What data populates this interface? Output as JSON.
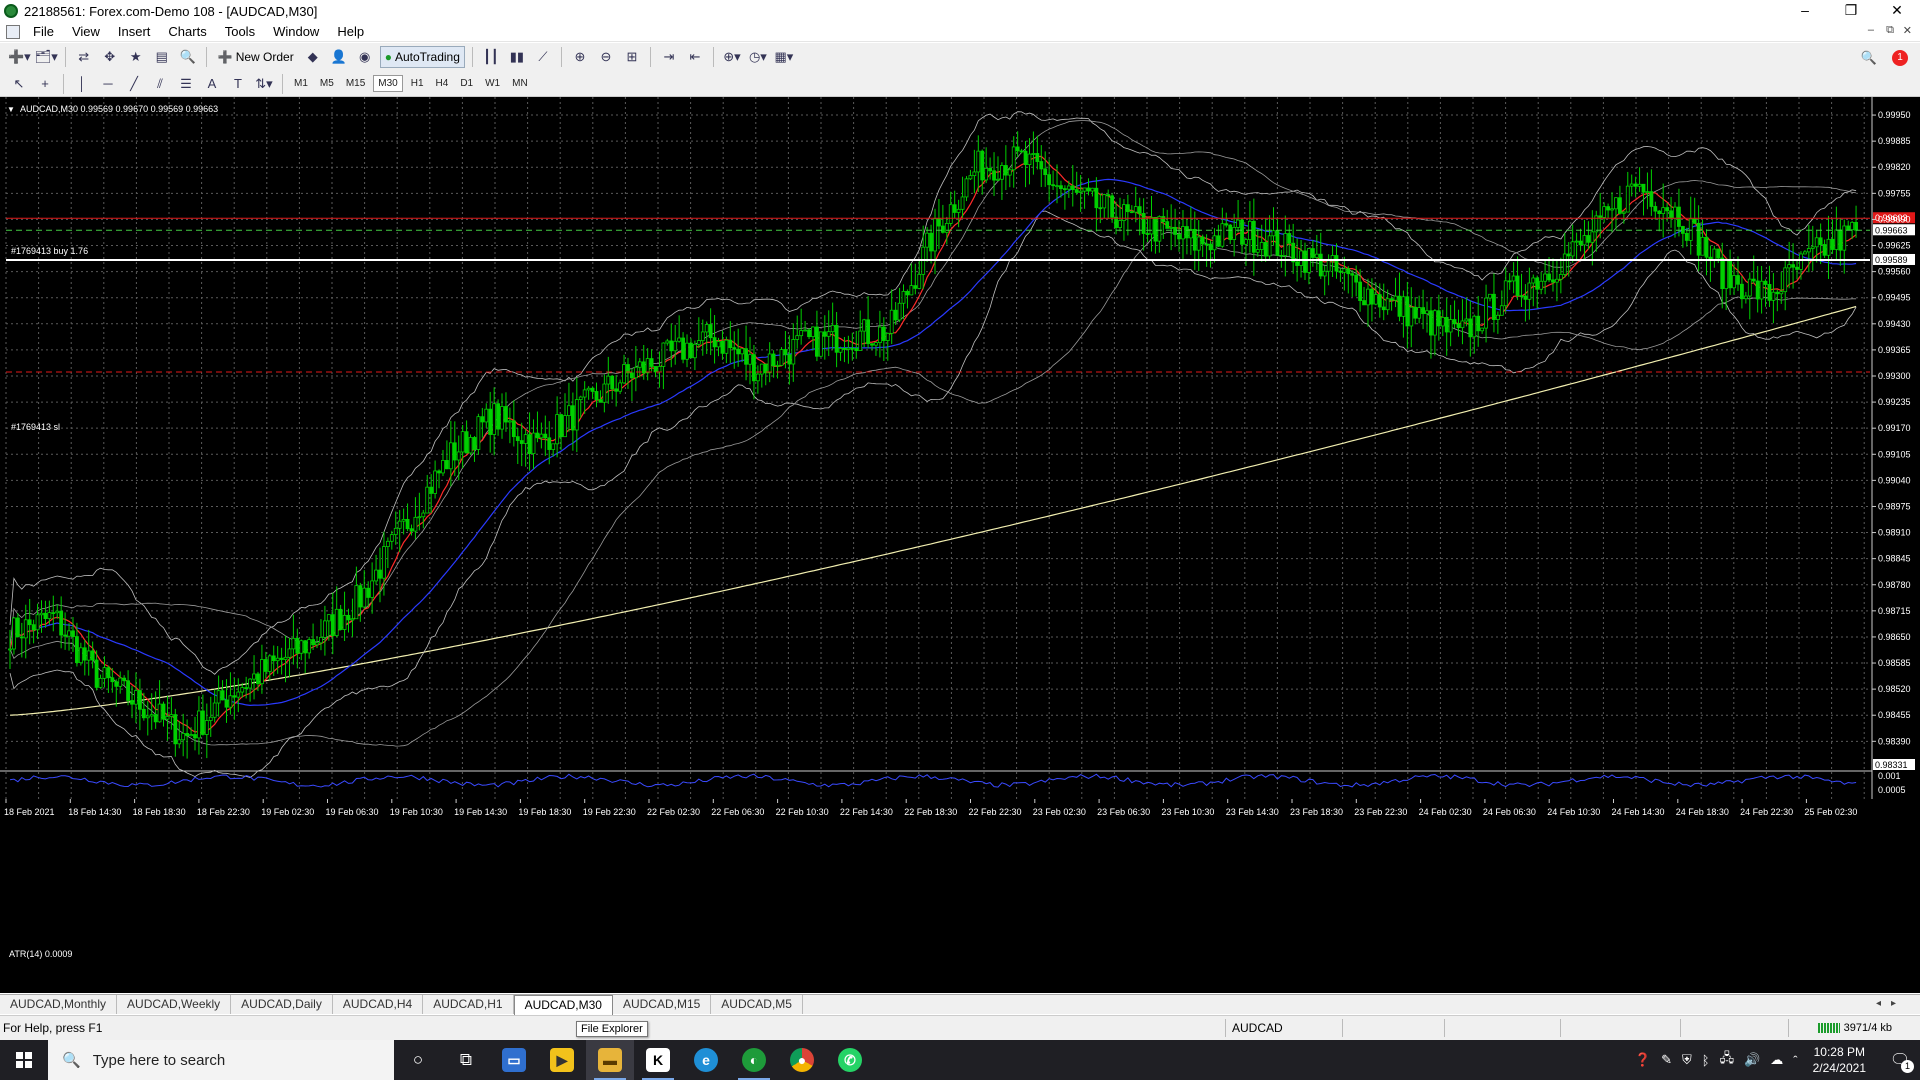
{
  "window": {
    "title": "22188561: Forex.com-Demo 108 - [AUDCAD,M30]",
    "controls": [
      "–",
      "❐",
      "✕"
    ],
    "mdi_controls": [
      "–",
      "⧉",
      "✕"
    ]
  },
  "menu": [
    "File",
    "View",
    "Insert",
    "Charts",
    "Tools",
    "Window",
    "Help"
  ],
  "toolbar": {
    "new_order": "New Order",
    "auto_trading": "AutoTrading",
    "notification_count": "1"
  },
  "timeframes": [
    "M1",
    "M5",
    "M15",
    "M30",
    "H1",
    "H4",
    "D1",
    "W1",
    "MN"
  ],
  "active_timeframe": "M30",
  "chart": {
    "header": "AUDCAD,M30  0.99569 0.99670 0.99569 0.99663",
    "order_label": "#1769413 buy 1.76",
    "sl_label": "#1769413 sl",
    "atr_label": "ATR(14) 0.0009",
    "current_price": "0.99663",
    "red_price": "0.99693",
    "white_line_price": "0.99589",
    "bottom_price": "0.98331",
    "atr_scale": [
      "0.001",
      "0.0005"
    ],
    "colors": {
      "background": "#000000",
      "grid": "#5a5a5a",
      "candle": "#00d000",
      "ma_red": "#ff2a2a",
      "ma_blue": "#2a3aff",
      "ma_yellow": "#f2efb0",
      "bands": "#c0c0c0"
    }
  },
  "chart_data": {
    "type": "line",
    "title": "AUDCAD,M30  0.99569 0.99670 0.99569 0.99663",
    "y_ticks": [
      0.9995,
      0.99885,
      0.9982,
      0.99755,
      0.9969,
      0.99625,
      0.9956,
      0.99495,
      0.9943,
      0.99365,
      0.993,
      0.99235,
      0.9917,
      0.99105,
      0.9904,
      0.98975,
      0.9891,
      0.98845,
      0.9878,
      0.98715,
      0.9865,
      0.98585,
      0.9852,
      0.98455,
      0.9839
    ],
    "ylim": [
      0.98331,
      0.9999
    ],
    "x_ticks": [
      "18 Feb 2021",
      "18 Feb 14:30",
      "18 Feb 18:30",
      "18 Feb 22:30",
      "19 Feb 02:30",
      "19 Feb 06:30",
      "19 Feb 10:30",
      "19 Feb 14:30",
      "19 Feb 18:30",
      "19 Feb 22:30",
      "22 Feb 02:30",
      "22 Feb 06:30",
      "22 Feb 10:30",
      "22 Feb 14:30",
      "22 Feb 18:30",
      "22 Feb 22:30",
      "23 Feb 02:30",
      "23 Feb 06:30",
      "23 Feb 10:30",
      "23 Feb 14:30",
      "23 Feb 18:30",
      "23 Feb 22:30",
      "24 Feb 02:30",
      "24 Feb 06:30",
      "24 Feb 10:30",
      "24 Feb 14:30",
      "24 Feb 18:30",
      "24 Feb 22:30",
      "25 Feb 02:30"
    ],
    "close_anchors": [
      0.9866,
      0.987,
      0.9855,
      0.9848,
      0.984,
      0.9851,
      0.9858,
      0.9865,
      0.9875,
      0.9893,
      0.991,
      0.992,
      0.9913,
      0.9922,
      0.993,
      0.9935,
      0.994,
      0.9932,
      0.9938,
      0.994,
      0.9941,
      0.9965,
      0.9982,
      0.9984,
      0.9976,
      0.9971,
      0.9967,
      0.9963,
      0.9966,
      0.9962,
      0.9957,
      0.995,
      0.9945,
      0.994,
      0.995,
      0.9956,
      0.9965,
      0.9978,
      0.997,
      0.9955,
      0.995,
      0.996,
      0.99663
    ],
    "order_buy_price": 0.99663,
    "stop_loss_price": 0.9931,
    "highlight_line_price": 0.99589,
    "red_line_price": 0.99693,
    "atr_value": 0.0009
  },
  "symbol_tabs": [
    "AUDCAD,Monthly",
    "AUDCAD,Weekly",
    "AUDCAD,Daily",
    "AUDCAD,H4",
    "AUDCAD,H1",
    "AUDCAD,M30",
    "AUDCAD,M15",
    "AUDCAD,M5"
  ],
  "active_tab": "AUDCAD,M30",
  "status": {
    "help": "For Help, press F1",
    "symbol": "AUDCAD",
    "memory": "3971/4 kb",
    "tooltip": "File Explorer"
  },
  "taskbar": {
    "search_placeholder": "Type here to search",
    "time": "10:28 PM",
    "date": "2/24/2021",
    "notifications": "1"
  }
}
